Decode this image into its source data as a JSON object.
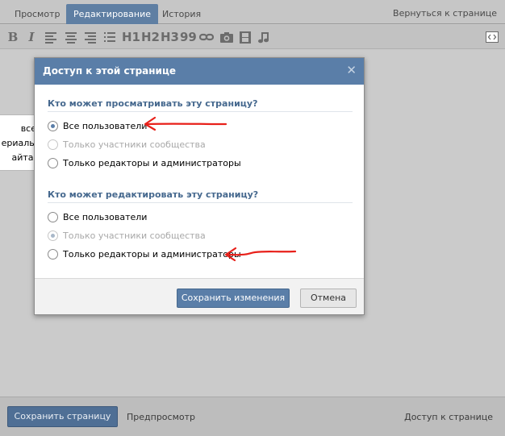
{
  "tabs": [
    {
      "label": "Просмотр",
      "active": false
    },
    {
      "label": "Редактирование",
      "active": true
    },
    {
      "label": "История",
      "active": false
    }
  ],
  "back_link": "Вернуться к странице",
  "toolbar": {
    "bold": "B",
    "italic": "I",
    "h1": "H1",
    "h2": "H2",
    "h3": "H3",
    "quote": "99",
    "icons": [
      "align-left-icon",
      "align-center-icon",
      "align-right-icon",
      "list-icon",
      "link-icon",
      "photo-icon",
      "video-icon",
      "audio-icon",
      "source-icon"
    ]
  },
  "tooltip": {
    "line1": "все",
    "line2": "ериалы",
    "line3": "айта."
  },
  "modal": {
    "title": "Доступ к этой странице",
    "close": "✕",
    "view_section": {
      "title": "Кто может просматривать эту страницу?",
      "options": [
        {
          "label": "Все пользователи",
          "checked": true,
          "disabled": false
        },
        {
          "label": "Только участники сообщества",
          "checked": false,
          "disabled": true
        },
        {
          "label": "Только редакторы и администраторы",
          "checked": false,
          "disabled": false
        }
      ]
    },
    "edit_section": {
      "title": "Кто может редактировать эту страницу?",
      "options": [
        {
          "label": "Все пользователи",
          "checked": false,
          "disabled": false
        },
        {
          "label": "Только участники сообщества",
          "checked": true,
          "disabled": true
        },
        {
          "label": "Только редакторы и администраторы",
          "checked": false,
          "disabled": false
        }
      ]
    },
    "save_label": "Сохранить изменения",
    "cancel_label": "Отмена"
  },
  "bottom": {
    "save_page": "Сохранить страницу",
    "preview": "Предпросмотр",
    "access": "Доступ к странице"
  },
  "colors": {
    "accent": "#5a7ea8",
    "annotation": "#e8201a"
  }
}
